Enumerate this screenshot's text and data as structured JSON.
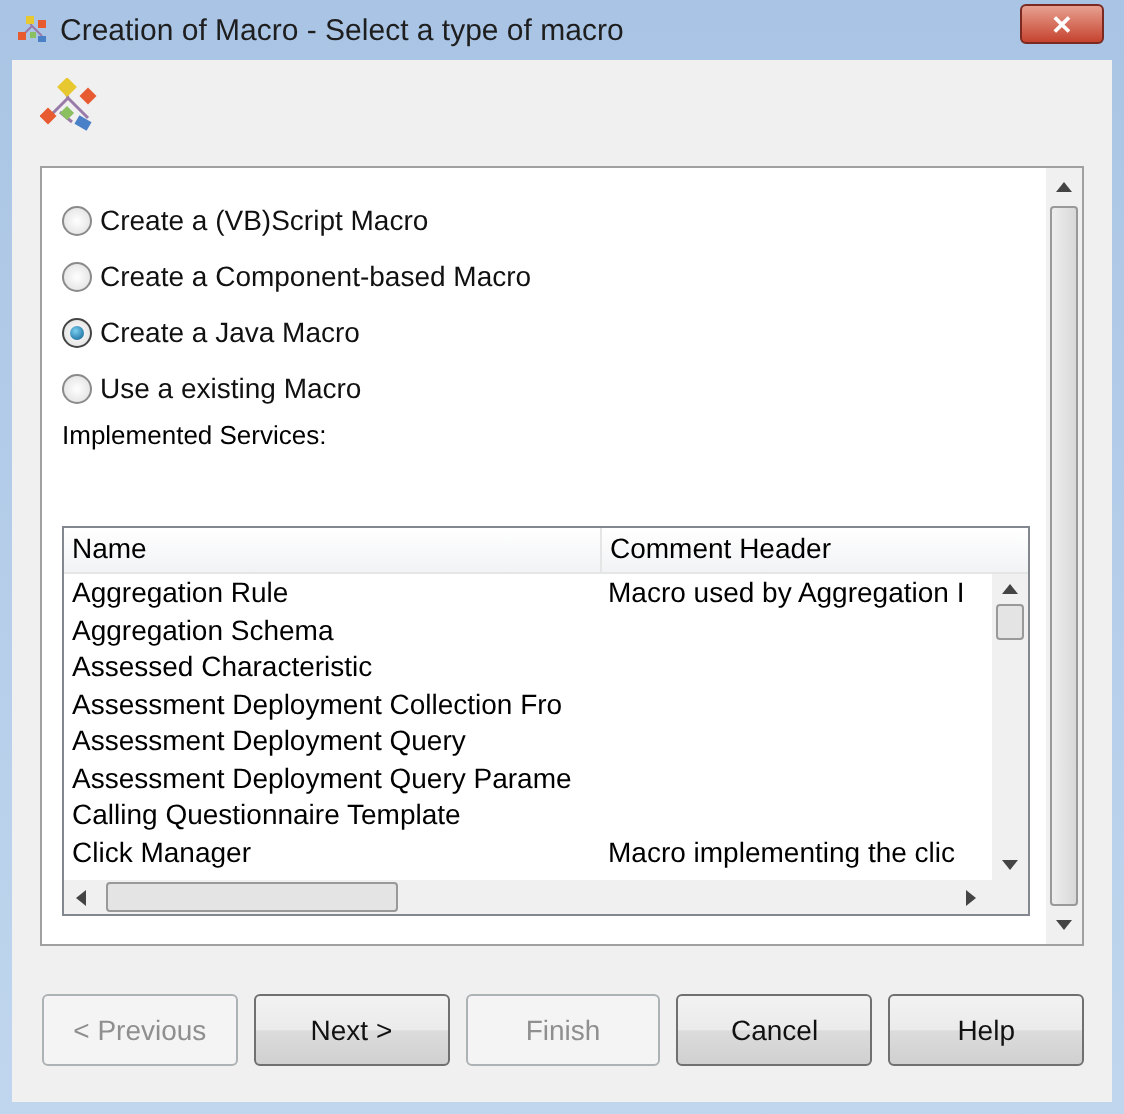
{
  "window": {
    "title": "Creation of Macro - Select a type of macro",
    "close": "✕"
  },
  "options": [
    {
      "label": "Create a (VB)Script Macro",
      "selected": false
    },
    {
      "label": "Create a Component-based Macro",
      "selected": false
    },
    {
      "label": "Create a Java Macro",
      "selected": true
    },
    {
      "label": "Use a existing Macro",
      "selected": false
    }
  ],
  "services_label": "Implemented Services:",
  "table": {
    "columns": [
      "Name",
      "Comment Header"
    ],
    "rows": [
      [
        "Aggregation Rule",
        "Macro used by Aggregation I"
      ],
      [
        "Aggregation Schema",
        ""
      ],
      [
        "Assessed Characteristic",
        ""
      ],
      [
        "Assessment Deployment Collection Fro",
        ""
      ],
      [
        "Assessment Deployment Query",
        ""
      ],
      [
        "Assessment Deployment Query Parame",
        ""
      ],
      [
        "Calling Questionnaire Template",
        ""
      ],
      [
        "Click Manager",
        "Macro implementing the clic"
      ]
    ]
  },
  "buttons": [
    {
      "label": "< Previous",
      "disabled": true
    },
    {
      "label": "Next >",
      "disabled": false
    },
    {
      "label": "Finish",
      "disabled": true
    },
    {
      "label": "Cancel",
      "disabled": false
    },
    {
      "label": "Help",
      "disabled": false
    }
  ]
}
